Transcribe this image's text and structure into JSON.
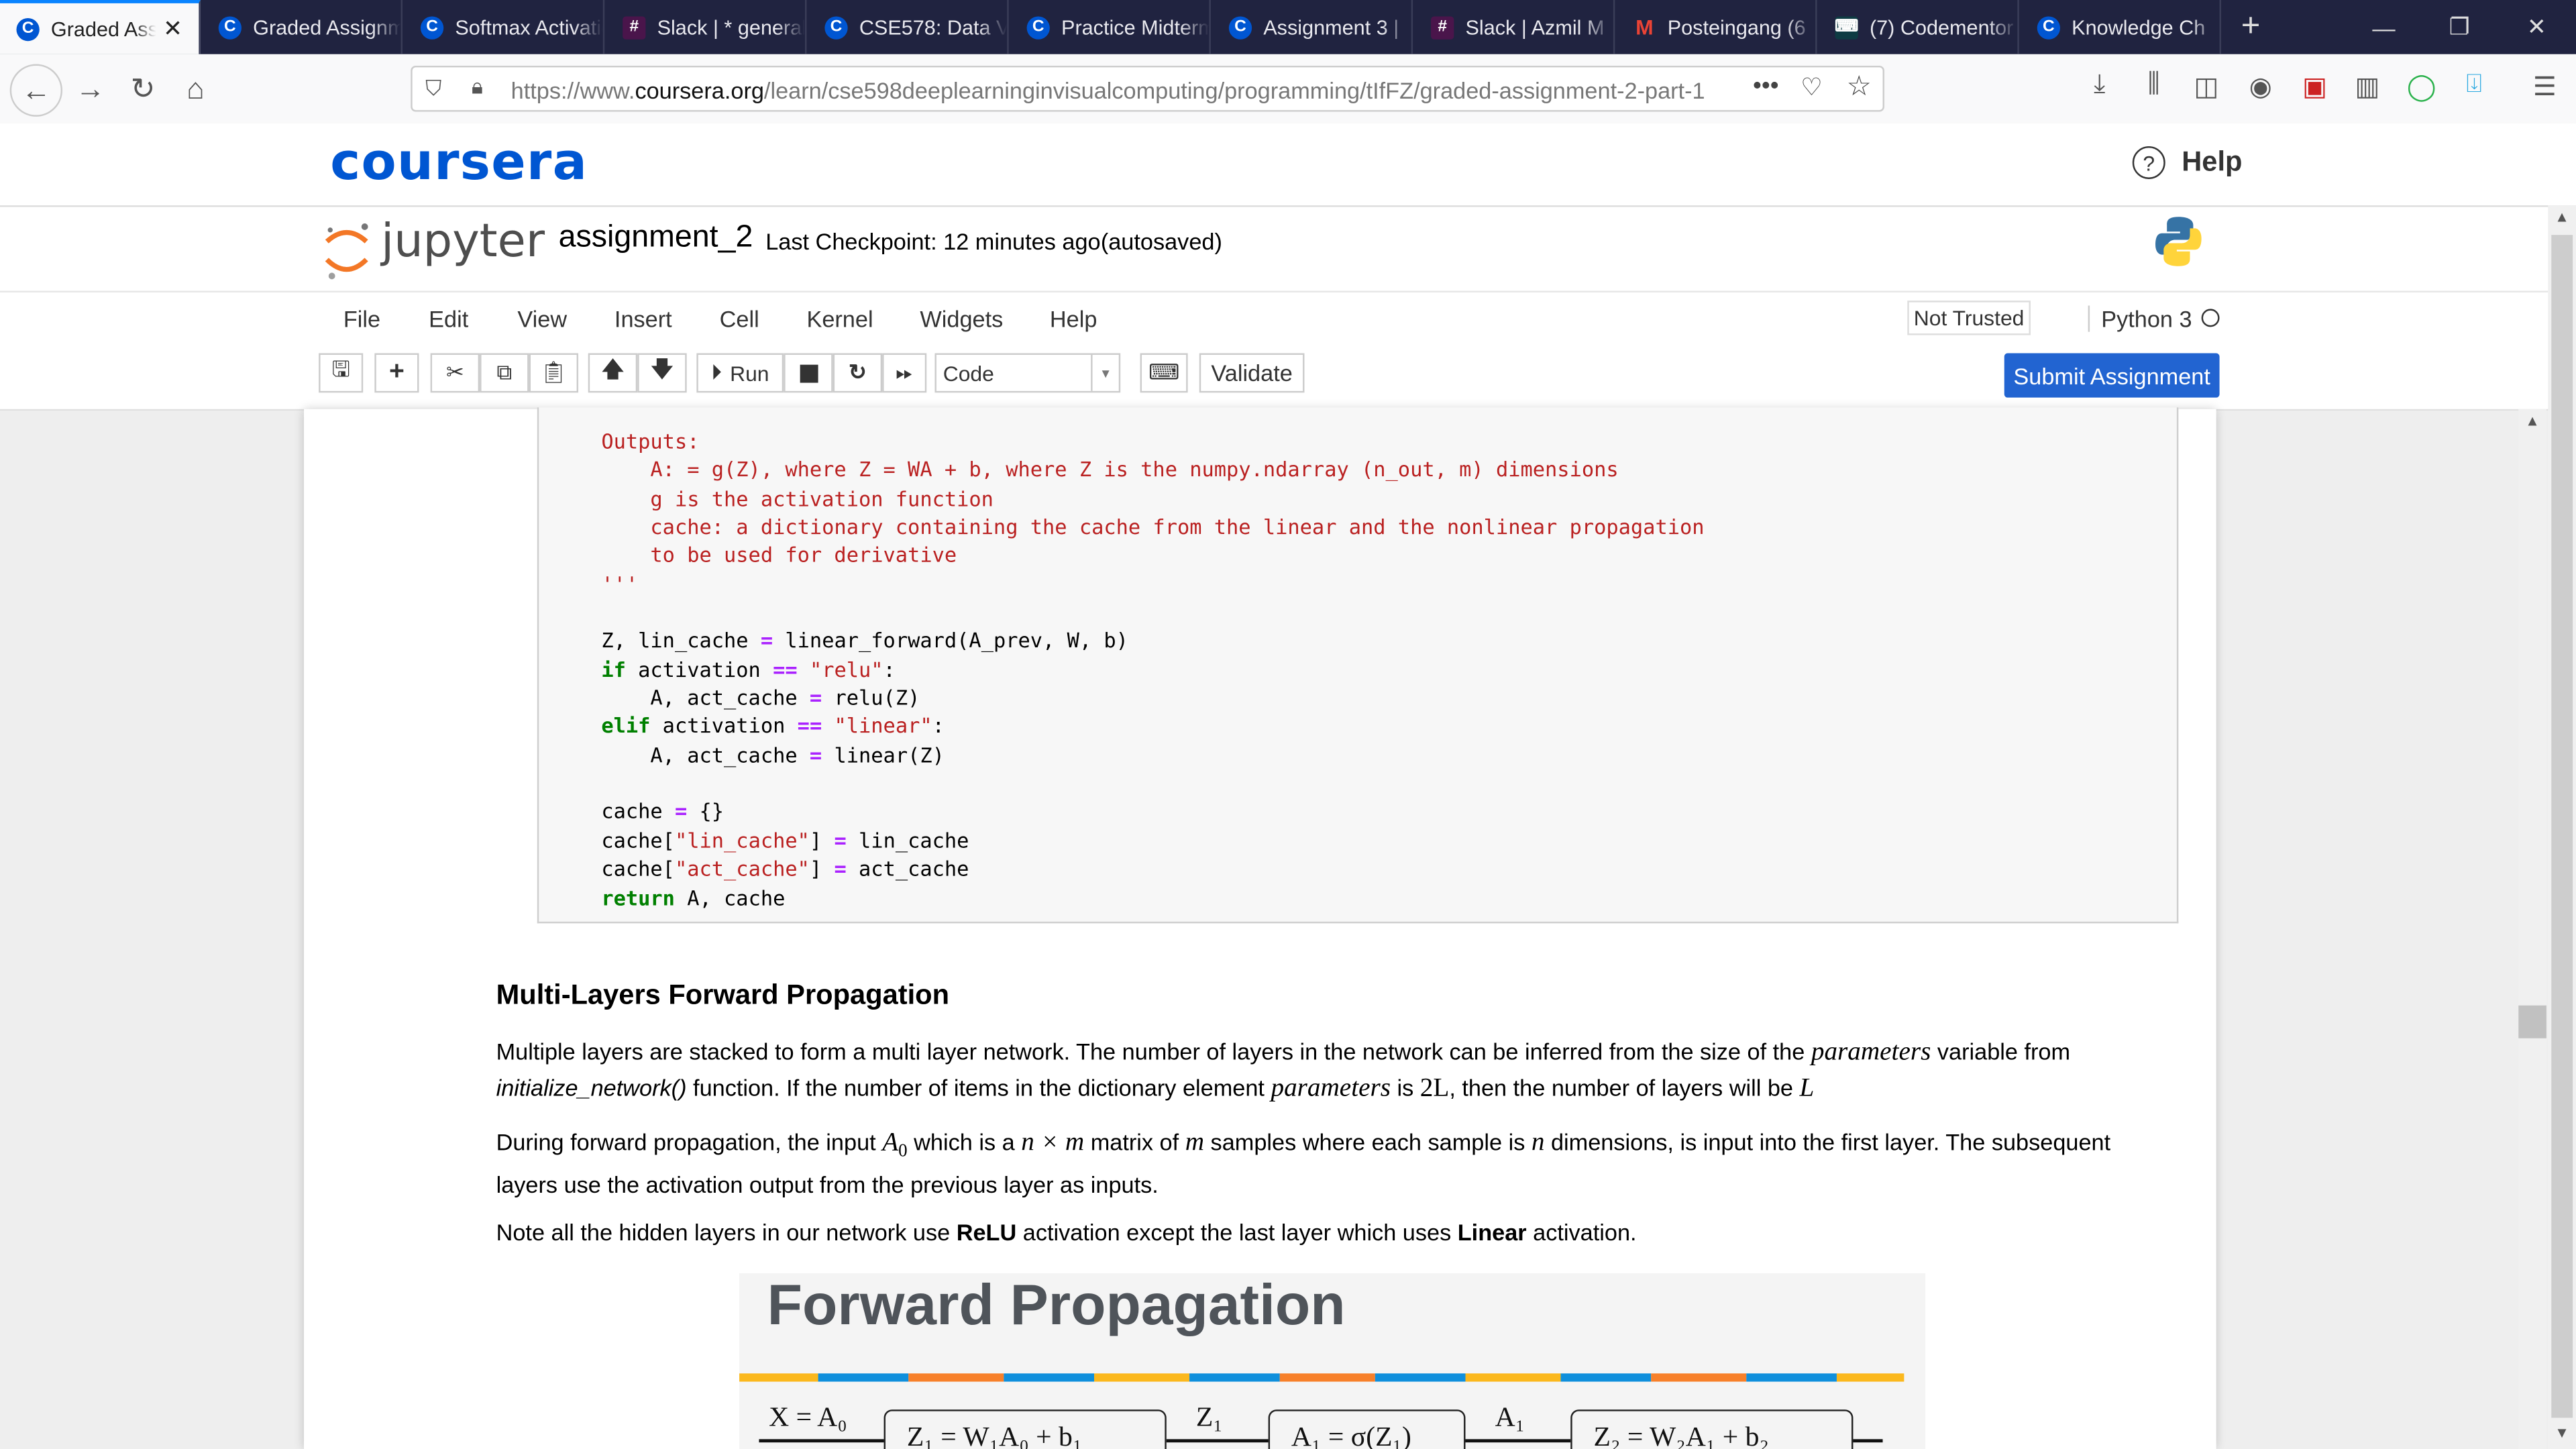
{
  "browser": {
    "tabs": [
      {
        "label": "Graded Assignment",
        "icon": "coursera-icon",
        "active": true
      },
      {
        "label": "Graded Assignment",
        "icon": "coursera-icon"
      },
      {
        "label": "Softmax Activation",
        "icon": "coursera-icon"
      },
      {
        "label": "Slack | * general",
        "icon": "slack-icon"
      },
      {
        "label": "CSE578: Data Vis",
        "icon": "coursera-icon"
      },
      {
        "label": "Practice Midterm",
        "icon": "coursera-icon"
      },
      {
        "label": "Assignment 3 |",
        "icon": "coursera-icon"
      },
      {
        "label": "Slack | Azmil M",
        "icon": "slack-icon"
      },
      {
        "label": "Posteingang (6",
        "icon": "gmail-icon"
      },
      {
        "label": "(7) Codementor",
        "icon": "codementor-icon"
      },
      {
        "label": "Knowledge Ch",
        "icon": "coursera-icon"
      }
    ],
    "url_prefix": "https://www.",
    "url_domain": "coursera.org",
    "url_path": "/learn/cse598deeplearninginvisualcomputing/programming/tIfFZ/graded-assignment-2-part-1"
  },
  "coursera": {
    "logo": "coursera",
    "help_label": "Help"
  },
  "jupyter": {
    "logo_text": "jupyter",
    "notebook_name": "assignment_2",
    "checkpoint": "Last Checkpoint: 12 minutes ago",
    "autosave": "(autosaved)",
    "menus": [
      "File",
      "Edit",
      "View",
      "Insert",
      "Cell",
      "Kernel",
      "Widgets",
      "Help"
    ],
    "trusted": "Not Trusted",
    "kernel": "Python 3",
    "toolbar": {
      "run": "Run",
      "cell_type": "Code",
      "validate": "Validate",
      "submit": "Submit Assignment"
    }
  },
  "code_lines": [
    [
      [
        "str",
        "Outputs:"
      ]
    ],
    [
      [
        "str",
        "    A: = g(Z), where Z = WA + b, where Z is the numpy.ndarray (n_out, m) dimensions"
      ]
    ],
    [
      [
        "str",
        "    g is the activation function"
      ]
    ],
    [
      [
        "str",
        "    cache: a dictionary containing the cache from the linear and the nonlinear propagation"
      ]
    ],
    [
      [
        "str",
        "    to be used for derivative"
      ]
    ],
    [
      [
        "str",
        "'''"
      ]
    ],
    [
      [
        "",
        ""
      ]
    ],
    [
      [
        "",
        "Z, lin_cache "
      ],
      [
        "op",
        "="
      ],
      [
        "",
        " linear_forward(A_prev, W, b)"
      ]
    ],
    [
      [
        "kw",
        "if"
      ],
      [
        "",
        " activation "
      ],
      [
        "op",
        "=="
      ],
      [
        "",
        ""
      ],
      [
        "str",
        " \"relu\""
      ],
      [
        "",
        ":"
      ]
    ],
    [
      [
        "",
        "    A, act_cache "
      ],
      [
        "op",
        "="
      ],
      [
        "",
        " relu(Z)"
      ]
    ],
    [
      [
        "kw",
        "elif"
      ],
      [
        "",
        " activation "
      ],
      [
        "op",
        "=="
      ],
      [
        "str",
        " \"linear\""
      ],
      [
        "",
        ":"
      ]
    ],
    [
      [
        "",
        "    A, act_cache "
      ],
      [
        "op",
        "="
      ],
      [
        "",
        " linear(Z)"
      ]
    ],
    [
      [
        "",
        ""
      ]
    ],
    [
      [
        "",
        "cache "
      ],
      [
        "op",
        "="
      ],
      [
        "",
        " {}"
      ]
    ],
    [
      [
        "",
        "cache["
      ],
      [
        "str",
        "\"lin_cache\""
      ],
      [
        "",
        "] "
      ],
      [
        "op",
        "="
      ],
      [
        "",
        " lin_cache"
      ]
    ],
    [
      [
        "",
        "cache["
      ],
      [
        "str",
        "\"act_cache\""
      ],
      [
        "",
        "] "
      ],
      [
        "op",
        "="
      ],
      [
        "",
        " act_cache"
      ]
    ],
    [
      [
        "kw",
        "return"
      ],
      [
        "",
        " A, cache"
      ]
    ]
  ],
  "markdown": {
    "heading": "Multi-Layers Forward Propagation",
    "p1": {
      "a": "Multiple layers are stacked to form a multi layer network. The number of layers in the network can be inferred from the size of the ",
      "b": "parameters",
      "c": " variable from ",
      "d": "initialize_network()",
      "e": " function. If the number of items in the dictionary element ",
      "f": "parameters",
      "g": " is ",
      "h": "2L",
      "i": ", then the number of layers will be ",
      "j": "L"
    },
    "p2": {
      "a": "During forward propagation, the input ",
      "b": "A",
      "b_sub": "0",
      "c": " which is a ",
      "d": "n × m",
      "e": " matrix of ",
      "f": "m",
      "g": " samples where each sample is ",
      "h": "n",
      "i": " dimensions, is input into the first layer. The subsequent layers use the activation output from the previous layer as inputs."
    },
    "p3": {
      "a": "Note all the hidden layers in our network use ",
      "b": "ReLU",
      "c": " activation except the last layer which uses ",
      "d": "Linear",
      "e": " activation."
    }
  },
  "figure": {
    "title": "Forward Propagation",
    "stripe_colors": [
      "#fbb81d",
      "#0f8fdc",
      "#f7802a",
      "#0f8fdc",
      "#fbb81d",
      "#0f8fdc",
      "#f7802a",
      "#0f8fdc",
      "#fbb81d",
      "#0f8fdc",
      "#f7802a",
      "#0f8fdc",
      "#fbb81d"
    ],
    "input_label": "X = A₀",
    "box1": "Z₁ = W₁A₀ + b₁",
    "z1": "Z₁",
    "box2": "A₁ = σ(Z₁)",
    "a1": "A₁",
    "box3": "Z₂ = W₂A₁ + b₂"
  },
  "colors": {
    "coursera_blue": "#0056d2",
    "submit_blue": "#2264d1",
    "tabbar": "#202340"
  }
}
